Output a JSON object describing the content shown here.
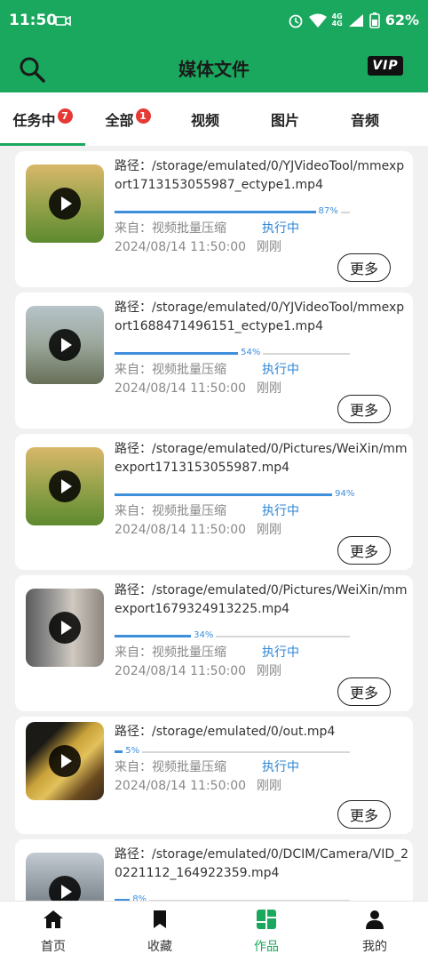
{
  "statusbar": {
    "time": "11:50",
    "battery": "62%",
    "net_top": "4G",
    "net_bottom": "4G"
  },
  "appbar": {
    "title": "媒体文件",
    "vip": "VIP"
  },
  "tabs": [
    {
      "label": "任务中",
      "badge": "7"
    },
    {
      "label": "全部",
      "badge": "1"
    },
    {
      "label": "视频"
    },
    {
      "label": "图片"
    },
    {
      "label": "音频"
    }
  ],
  "tasks": [
    {
      "path": "路径：/storage/emulated/0/YJVideoTool/mmexport1713153055987_ectype1.mp4",
      "progress": 87,
      "progress_label": "87%",
      "from": "来自：视频批量压缩",
      "status": "执行中",
      "time": "2024/08/14 11:50:00",
      "relative": "刚刚",
      "more": "更多"
    },
    {
      "path": "路径：/storage/emulated/0/YJVideoTool/mmexport1688471496151_ectype1.mp4",
      "progress": 54,
      "progress_label": "54%",
      "from": "来自：视频批量压缩",
      "status": "执行中",
      "time": "2024/08/14 11:50:00",
      "relative": "刚刚",
      "more": "更多"
    },
    {
      "path": "路径：/storage/emulated/0/Pictures/WeiXin/mmexport1713153055987.mp4",
      "progress": 94,
      "progress_label": "94%",
      "from": "来自：视频批量压缩",
      "status": "执行中",
      "time": "2024/08/14 11:50:00",
      "relative": "刚刚",
      "more": "更多"
    },
    {
      "path": "路径：/storage/emulated/0/Pictures/WeiXin/mmexport1679324913225.mp4",
      "progress": 34,
      "progress_label": "34%",
      "from": "来自：视频批量压缩",
      "status": "执行中",
      "time": "2024/08/14 11:50:00",
      "relative": "刚刚",
      "more": "更多"
    },
    {
      "path": "路径：/storage/emulated/0/out.mp4",
      "progress": 5,
      "progress_label": "5%",
      "from": "来自：视频批量压缩",
      "status": "执行中",
      "time": "2024/08/14 11:50:00",
      "relative": "刚刚",
      "more": "更多"
    },
    {
      "path": "路径：/storage/emulated/0/DCIM/Camera/VID_20221112_164922359.mp4",
      "progress": 8,
      "progress_label": "8%"
    }
  ],
  "bottomnav": [
    {
      "label": "首页"
    },
    {
      "label": "收藏"
    },
    {
      "label": "作品"
    },
    {
      "label": "我的"
    }
  ],
  "colors": {
    "brand": "#1aa85e",
    "progress": "#3d8fdc",
    "badge": "#e53935"
  }
}
